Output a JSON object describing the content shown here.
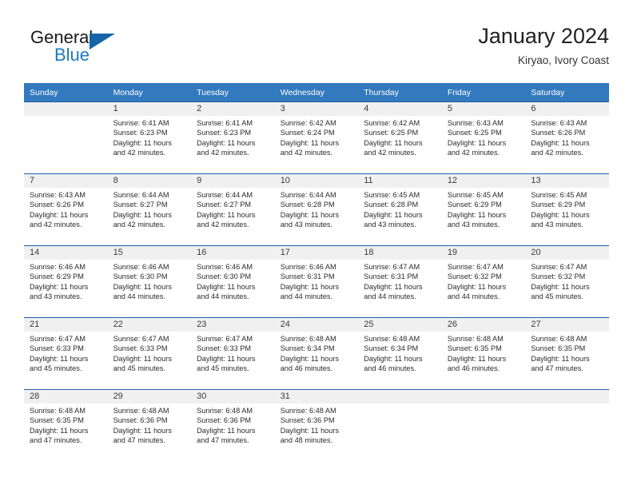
{
  "branding": {
    "name_part1": "General",
    "name_part2": "Blue",
    "triangle_icon": "logo-triangle-icon",
    "accent_color": "#1f78c1",
    "triangle_color": "#1565a8"
  },
  "header": {
    "title": "January 2024",
    "subtitle": "Kiryao, Ivory Coast"
  },
  "theme": {
    "header_row_bg": "#3379bd",
    "week_divider": "#1f5fa9",
    "daynum_band_bg": "#f0f0f0",
    "text_color": "#2b2b2b"
  },
  "weekday_headers": [
    "Sunday",
    "Monday",
    "Tuesday",
    "Wednesday",
    "Thursday",
    "Friday",
    "Saturday"
  ],
  "weeks": [
    [
      {
        "day": "",
        "sunrise": "",
        "sunset": "",
        "daylight_line1": "",
        "daylight_line2": ""
      },
      {
        "day": "1",
        "sunrise": "Sunrise: 6:41 AM",
        "sunset": "Sunset: 6:23 PM",
        "daylight_line1": "Daylight: 11 hours",
        "daylight_line2": "and 42 minutes."
      },
      {
        "day": "2",
        "sunrise": "Sunrise: 6:41 AM",
        "sunset": "Sunset: 6:23 PM",
        "daylight_line1": "Daylight: 11 hours",
        "daylight_line2": "and 42 minutes."
      },
      {
        "day": "3",
        "sunrise": "Sunrise: 6:42 AM",
        "sunset": "Sunset: 6:24 PM",
        "daylight_line1": "Daylight: 11 hours",
        "daylight_line2": "and 42 minutes."
      },
      {
        "day": "4",
        "sunrise": "Sunrise: 6:42 AM",
        "sunset": "Sunset: 6:25 PM",
        "daylight_line1": "Daylight: 11 hours",
        "daylight_line2": "and 42 minutes."
      },
      {
        "day": "5",
        "sunrise": "Sunrise: 6:43 AM",
        "sunset": "Sunset: 6:25 PM",
        "daylight_line1": "Daylight: 11 hours",
        "daylight_line2": "and 42 minutes."
      },
      {
        "day": "6",
        "sunrise": "Sunrise: 6:43 AM",
        "sunset": "Sunset: 6:26 PM",
        "daylight_line1": "Daylight: 11 hours",
        "daylight_line2": "and 42 minutes."
      }
    ],
    [
      {
        "day": "7",
        "sunrise": "Sunrise: 6:43 AM",
        "sunset": "Sunset: 6:26 PM",
        "daylight_line1": "Daylight: 11 hours",
        "daylight_line2": "and 42 minutes."
      },
      {
        "day": "8",
        "sunrise": "Sunrise: 6:44 AM",
        "sunset": "Sunset: 6:27 PM",
        "daylight_line1": "Daylight: 11 hours",
        "daylight_line2": "and 42 minutes."
      },
      {
        "day": "9",
        "sunrise": "Sunrise: 6:44 AM",
        "sunset": "Sunset: 6:27 PM",
        "daylight_line1": "Daylight: 11 hours",
        "daylight_line2": "and 42 minutes."
      },
      {
        "day": "10",
        "sunrise": "Sunrise: 6:44 AM",
        "sunset": "Sunset: 6:28 PM",
        "daylight_line1": "Daylight: 11 hours",
        "daylight_line2": "and 43 minutes."
      },
      {
        "day": "11",
        "sunrise": "Sunrise: 6:45 AM",
        "sunset": "Sunset: 6:28 PM",
        "daylight_line1": "Daylight: 11 hours",
        "daylight_line2": "and 43 minutes."
      },
      {
        "day": "12",
        "sunrise": "Sunrise: 6:45 AM",
        "sunset": "Sunset: 6:29 PM",
        "daylight_line1": "Daylight: 11 hours",
        "daylight_line2": "and 43 minutes."
      },
      {
        "day": "13",
        "sunrise": "Sunrise: 6:45 AM",
        "sunset": "Sunset: 6:29 PM",
        "daylight_line1": "Daylight: 11 hours",
        "daylight_line2": "and 43 minutes."
      }
    ],
    [
      {
        "day": "14",
        "sunrise": "Sunrise: 6:46 AM",
        "sunset": "Sunset: 6:29 PM",
        "daylight_line1": "Daylight: 11 hours",
        "daylight_line2": "and 43 minutes."
      },
      {
        "day": "15",
        "sunrise": "Sunrise: 6:46 AM",
        "sunset": "Sunset: 6:30 PM",
        "daylight_line1": "Daylight: 11 hours",
        "daylight_line2": "and 44 minutes."
      },
      {
        "day": "16",
        "sunrise": "Sunrise: 6:46 AM",
        "sunset": "Sunset: 6:30 PM",
        "daylight_line1": "Daylight: 11 hours",
        "daylight_line2": "and 44 minutes."
      },
      {
        "day": "17",
        "sunrise": "Sunrise: 6:46 AM",
        "sunset": "Sunset: 6:31 PM",
        "daylight_line1": "Daylight: 11 hours",
        "daylight_line2": "and 44 minutes."
      },
      {
        "day": "18",
        "sunrise": "Sunrise: 6:47 AM",
        "sunset": "Sunset: 6:31 PM",
        "daylight_line1": "Daylight: 11 hours",
        "daylight_line2": "and 44 minutes."
      },
      {
        "day": "19",
        "sunrise": "Sunrise: 6:47 AM",
        "sunset": "Sunset: 6:32 PM",
        "daylight_line1": "Daylight: 11 hours",
        "daylight_line2": "and 44 minutes."
      },
      {
        "day": "20",
        "sunrise": "Sunrise: 6:47 AM",
        "sunset": "Sunset: 6:32 PM",
        "daylight_line1": "Daylight: 11 hours",
        "daylight_line2": "and 45 minutes."
      }
    ],
    [
      {
        "day": "21",
        "sunrise": "Sunrise: 6:47 AM",
        "sunset": "Sunset: 6:33 PM",
        "daylight_line1": "Daylight: 11 hours",
        "daylight_line2": "and 45 minutes."
      },
      {
        "day": "22",
        "sunrise": "Sunrise: 6:47 AM",
        "sunset": "Sunset: 6:33 PM",
        "daylight_line1": "Daylight: 11 hours",
        "daylight_line2": "and 45 minutes."
      },
      {
        "day": "23",
        "sunrise": "Sunrise: 6:47 AM",
        "sunset": "Sunset: 6:33 PM",
        "daylight_line1": "Daylight: 11 hours",
        "daylight_line2": "and 45 minutes."
      },
      {
        "day": "24",
        "sunrise": "Sunrise: 6:48 AM",
        "sunset": "Sunset: 6:34 PM",
        "daylight_line1": "Daylight: 11 hours",
        "daylight_line2": "and 46 minutes."
      },
      {
        "day": "25",
        "sunrise": "Sunrise: 6:48 AM",
        "sunset": "Sunset: 6:34 PM",
        "daylight_line1": "Daylight: 11 hours",
        "daylight_line2": "and 46 minutes."
      },
      {
        "day": "26",
        "sunrise": "Sunrise: 6:48 AM",
        "sunset": "Sunset: 6:35 PM",
        "daylight_line1": "Daylight: 11 hours",
        "daylight_line2": "and 46 minutes."
      },
      {
        "day": "27",
        "sunrise": "Sunrise: 6:48 AM",
        "sunset": "Sunset: 6:35 PM",
        "daylight_line1": "Daylight: 11 hours",
        "daylight_line2": "and 47 minutes."
      }
    ],
    [
      {
        "day": "28",
        "sunrise": "Sunrise: 6:48 AM",
        "sunset": "Sunset: 6:35 PM",
        "daylight_line1": "Daylight: 11 hours",
        "daylight_line2": "and 47 minutes."
      },
      {
        "day": "29",
        "sunrise": "Sunrise: 6:48 AM",
        "sunset": "Sunset: 6:36 PM",
        "daylight_line1": "Daylight: 11 hours",
        "daylight_line2": "and 47 minutes."
      },
      {
        "day": "30",
        "sunrise": "Sunrise: 6:48 AM",
        "sunset": "Sunset: 6:36 PM",
        "daylight_line1": "Daylight: 11 hours",
        "daylight_line2": "and 47 minutes."
      },
      {
        "day": "31",
        "sunrise": "Sunrise: 6:48 AM",
        "sunset": "Sunset: 6:36 PM",
        "daylight_line1": "Daylight: 11 hours",
        "daylight_line2": "and 48 minutes."
      },
      {
        "day": "",
        "sunrise": "",
        "sunset": "",
        "daylight_line1": "",
        "daylight_line2": ""
      },
      {
        "day": "",
        "sunrise": "",
        "sunset": "",
        "daylight_line1": "",
        "daylight_line2": ""
      },
      {
        "day": "",
        "sunrise": "",
        "sunset": "",
        "daylight_line1": "",
        "daylight_line2": ""
      }
    ]
  ]
}
